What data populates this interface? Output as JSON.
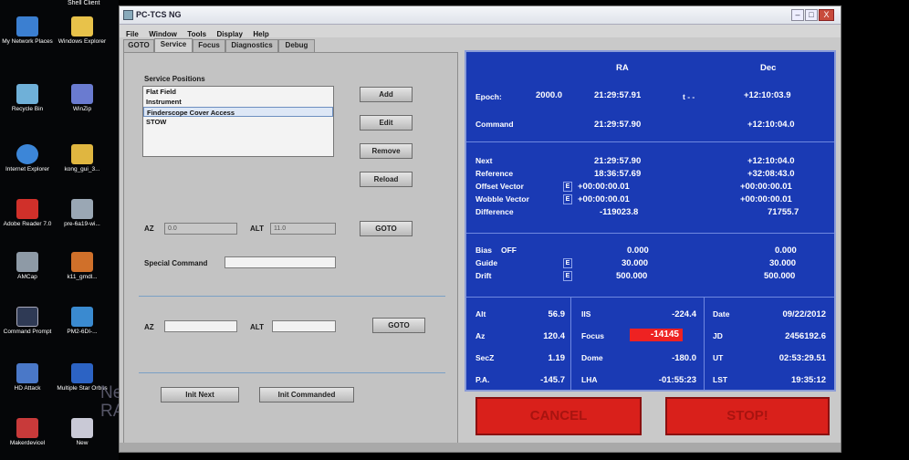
{
  "desktop": {
    "top_label": "Shell Client",
    "icons": [
      {
        "label": "My Network Places",
        "color": "#3b7fd1"
      },
      {
        "label": "Windows Explorer",
        "color": "#e8c24a"
      },
      {
        "label": "Recycle Bin",
        "color": "#6fb0d8"
      },
      {
        "label": "WinZip",
        "color": "#6a7bd0"
      },
      {
        "label": "Internet Explorer",
        "color": "#3c86d8"
      },
      {
        "label": "kong_gui_3...",
        "color": "#e0b640"
      },
      {
        "label": "Adobe Reader 7.0",
        "color": "#d0302a"
      },
      {
        "label": "pre-6a19-wi...",
        "color": "#9aa7b4"
      },
      {
        "label": "AMCap",
        "color": "#8e9aa6"
      },
      {
        "label": "k11_gmdl...",
        "color": "#d0702a"
      },
      {
        "label": "Command Prompt",
        "color": "#2f3a55"
      },
      {
        "label": "PM2-6DI-...",
        "color": "#3a8ad0"
      },
      {
        "label": "HD Attack",
        "color": "#4a78c8"
      },
      {
        "label": "Multiple Star Orbits",
        "color": "#2c63c4"
      },
      {
        "label": "Makerdevicel",
        "color": "#c83a3a"
      },
      {
        "label": "New",
        "color": "#c9c9d6"
      }
    ],
    "ghost_text": [
      "Ne",
      "RA"
    ]
  },
  "window": {
    "title": "PC-TCS NG",
    "menu": [
      "File",
      "Window",
      "Tools",
      "Display",
      "Help"
    ],
    "tabs": [
      "GOTO",
      "Service",
      "Focus",
      "Diagnostics",
      "Debug"
    ],
    "active_tab": "Service",
    "buttons": {
      "minimize": "–",
      "maximize": "□",
      "close": "X"
    }
  },
  "service": {
    "heading": "Service Positions",
    "positions": [
      "Flat Field",
      "Instrument",
      "Finderscope Cover Access",
      "STOW"
    ],
    "selected": "Finderscope Cover Access",
    "add": "Add",
    "edit": "Edit",
    "remove": "Remove",
    "reload": "Reload",
    "az_label": "AZ",
    "az_value": "0.0",
    "alt_label": "ALT",
    "alt_value": "11.0",
    "goto1": "GOTO",
    "special_label": "Special Command",
    "special_value": "",
    "az2_label": "AZ",
    "az2_value": "",
    "alt2_label": "ALT",
    "alt2_value": "",
    "goto2": "GOTO",
    "init_next": "Init Next",
    "init_commanded": "Init Commanded"
  },
  "status": {
    "ra_header": "RA",
    "dec_header": "Dec",
    "epoch_label": "Epoch:",
    "epoch_value": "2000.0",
    "epoch_ra": "21:29:57.91",
    "epoch_arrow": "t - -",
    "epoch_dec": "+12:10:03.9",
    "command_label": "Command",
    "command_ra": "21:29:57.90",
    "command_dec": "+12:10:04.0",
    "next_label": "Next",
    "next_ra": "21:29:57.90",
    "next_dec": "+12:10:04.0",
    "reference_label": "Reference",
    "reference_ra": "18:36:57.69",
    "reference_dec": "+32:08:43.0",
    "offset_label": "Offset Vector",
    "offset_e": "E",
    "offset_ra": "+00:00:00.01",
    "offset_dec": "+00:00:00.01",
    "wobble_label": "Wobble Vector",
    "wobble_e": "E",
    "wobble_ra": "+00:00:00.01",
    "wobble_dec": "+00:00:00.01",
    "difference_label": "Difference",
    "difference_ra": "-119023.8",
    "difference_dec": "71755.7",
    "bias_label": "Bias",
    "bias_state": "OFF",
    "bias_ra": "0.000",
    "bias_dec": "0.000",
    "guide_label": "Guide",
    "guide_e": "E",
    "guide_ra": "30.000",
    "guide_dec": "30.000",
    "drift_label": "Drift",
    "drift_e": "E",
    "drift_ra": "500.000",
    "drift_dec": "500.000",
    "alt_label": "Alt",
    "alt_value": "56.9",
    "az_label": "Az",
    "az_value": "120.4",
    "secz_label": "SecZ",
    "secz_value": "1.19",
    "pa_label": "P.A.",
    "pa_value": "-145.7",
    "iis_label": "IIS",
    "iis_value": "-224.4",
    "focus_label": "Focus",
    "focus_value": "-14145",
    "dome_label": "Dome",
    "dome_value": "-180.0",
    "lha_label": "LHA",
    "lha_value": "-01:55:23",
    "date_label": "Date",
    "date_value": "09/22/2012",
    "jd_label": "JD",
    "jd_value": "2456192.6",
    "ut_label": "UT",
    "ut_value": "02:53:29.51",
    "lst_label": "LST",
    "lst_value": "19:35:12"
  },
  "actions": {
    "cancel": "CANCEL",
    "stop": "STOP!"
  }
}
